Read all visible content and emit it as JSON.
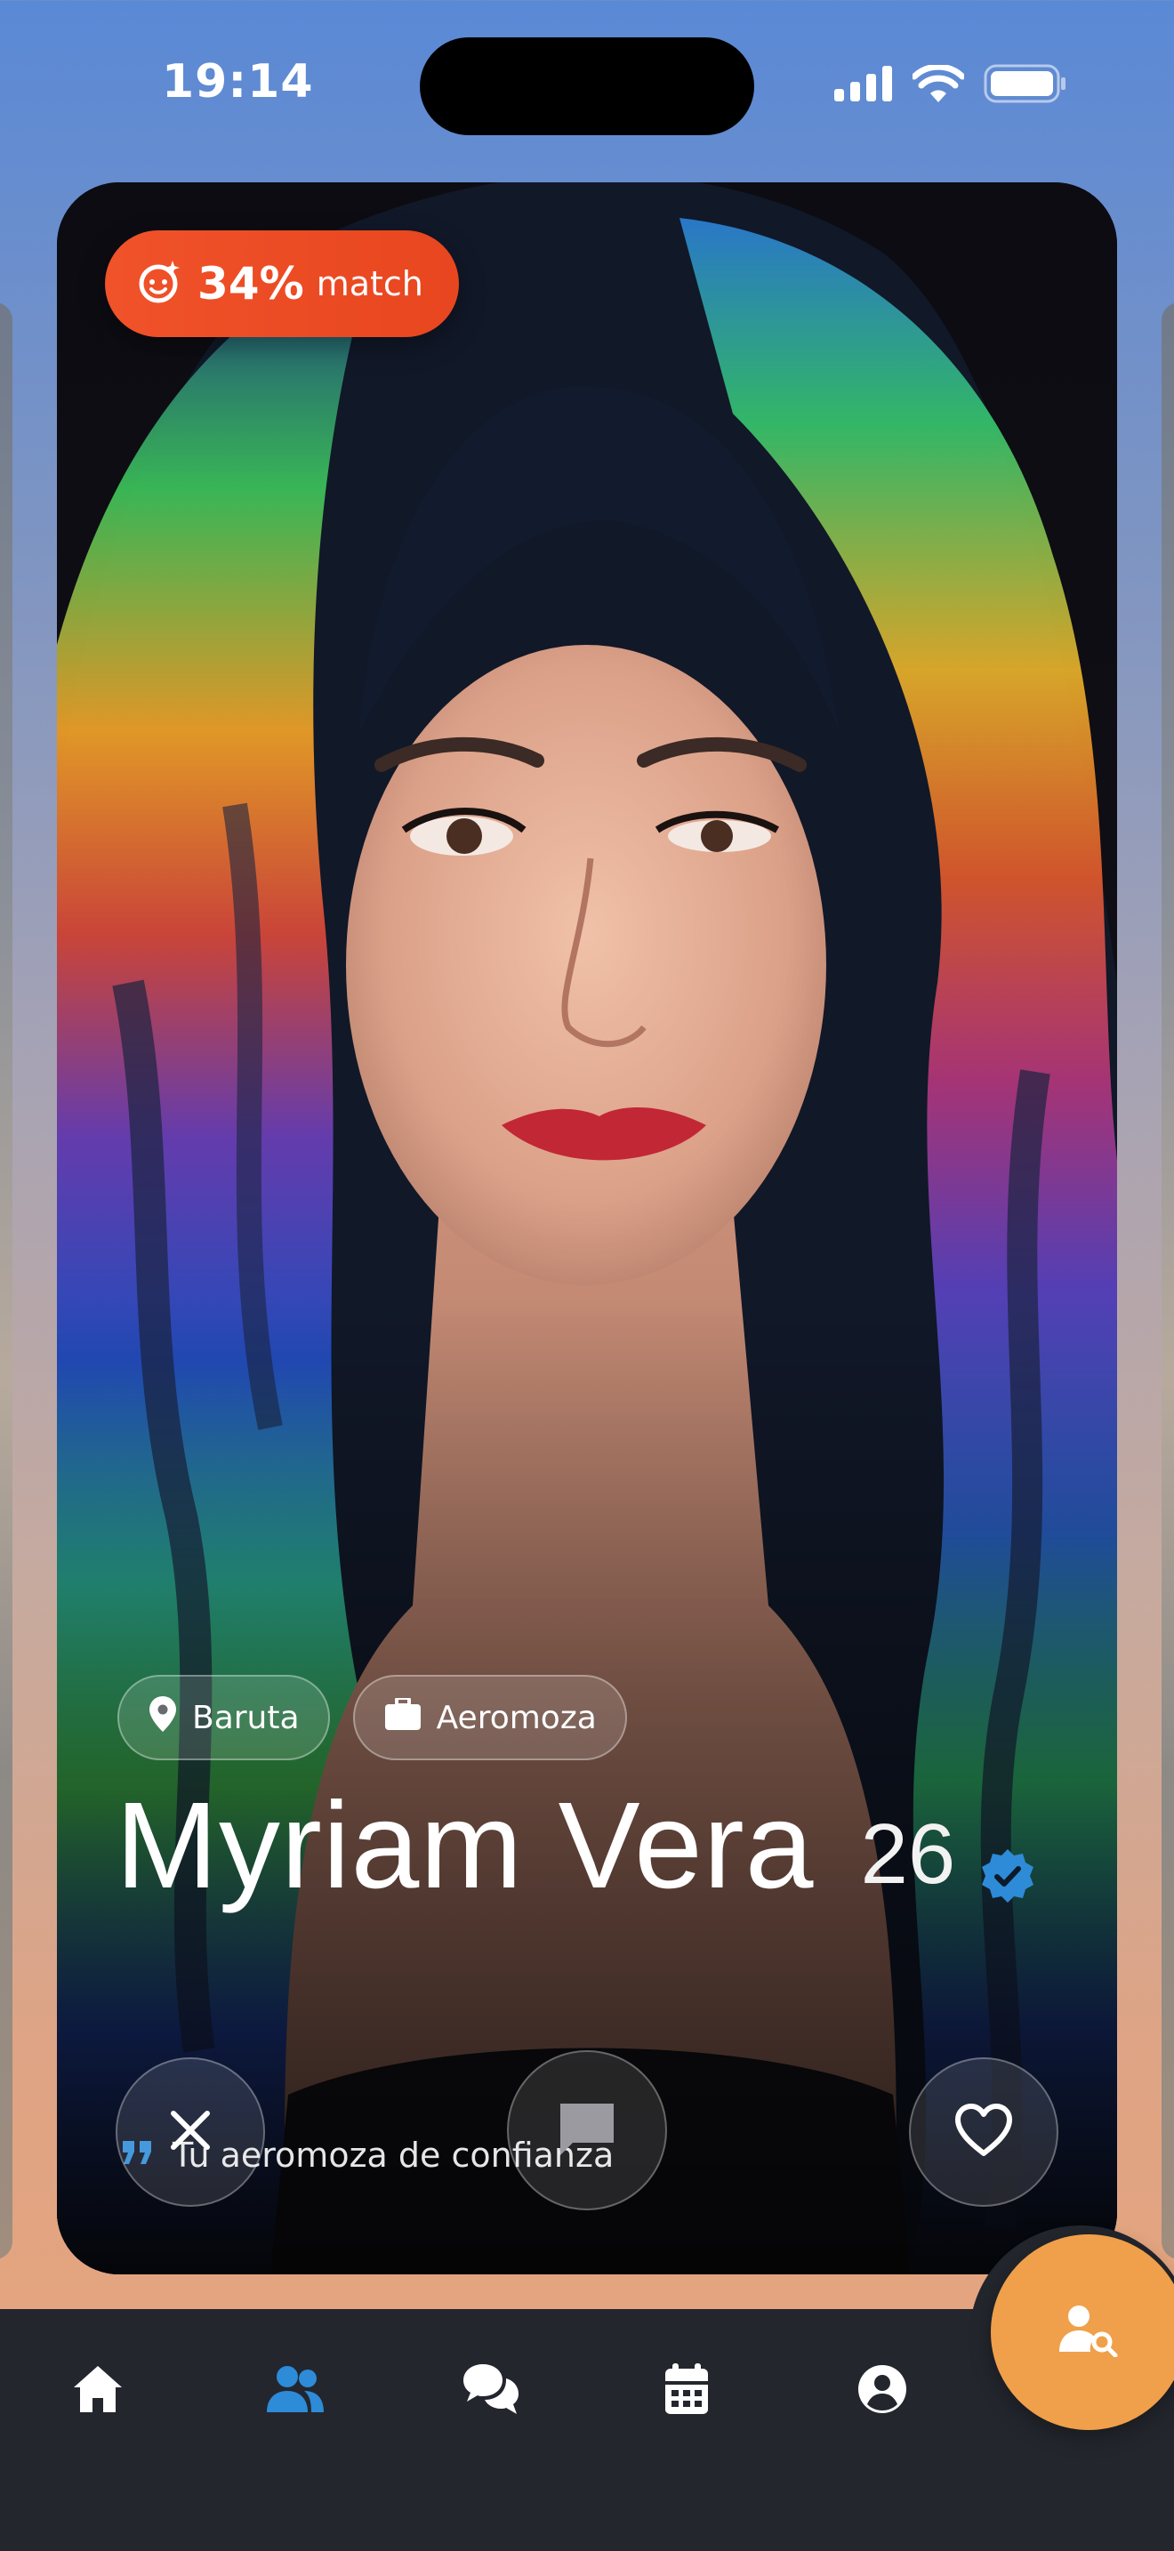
{
  "status_bar": {
    "time": "19:14",
    "icons": [
      "cellular-signal-icon",
      "wifi-icon",
      "battery-icon"
    ]
  },
  "profile": {
    "match_percent": "34%",
    "match_label": "match",
    "location": "Baruta",
    "occupation": "Aeromoza",
    "name": "Myriam Vera",
    "age": "26",
    "verified": true,
    "tagline": "Tu aeromoza de confianza"
  },
  "actions": {
    "dislike_icon": "close-icon",
    "message_icon": "chat-bubble-icon",
    "like_icon": "heart-icon"
  },
  "nav": {
    "items": [
      {
        "icon": "home-icon",
        "active": false
      },
      {
        "icon": "people-icon",
        "active": true
      },
      {
        "icon": "chats-icon",
        "active": false
      },
      {
        "icon": "calendar-icon",
        "active": false
      },
      {
        "icon": "user-circle-icon",
        "active": false
      }
    ],
    "fab_icon": "user-search-icon"
  },
  "colors": {
    "match_badge": "#EF4F27",
    "accent_blue": "#2D8BD8",
    "fab_orange": "#F0A04A",
    "nav_background": "#23262D",
    "verified_badge": "#2D8BD8"
  }
}
